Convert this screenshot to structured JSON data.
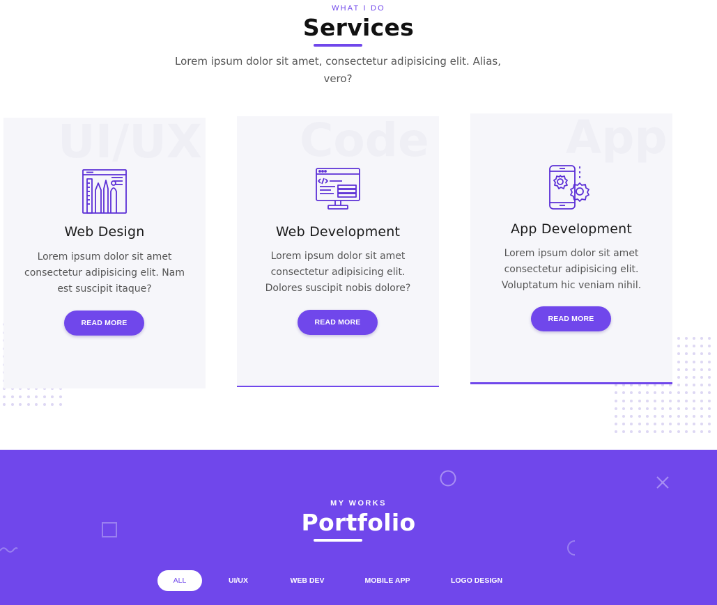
{
  "services": {
    "eyebrow": "WHAT I DO",
    "title": "Services",
    "intro": "Lorem ipsum dolor sit amet, consectetur adipisicing elit. Alias, vero?",
    "cards": [
      {
        "watermark": "UI/UX",
        "icon": "design-tools-icon",
        "title": "Web Design",
        "text": "Lorem ipsum dolor sit amet consectetur adipisicing elit. Nam est suscipit itaque?",
        "button": "READ MORE"
      },
      {
        "watermark": "Code",
        "icon": "code-monitor-icon",
        "title": "Web Development",
        "text": "Lorem ipsum dolor sit amet consectetur adipisicing elit. Dolores suscipit nobis dolore?",
        "button": "READ MORE"
      },
      {
        "watermark": "App",
        "icon": "mobile-gears-icon",
        "title": "App Development",
        "text": "Lorem ipsum dolor sit amet consectetur adipisicing elit. Voluptatum hic veniam nihil.",
        "button": "READ MORE"
      }
    ]
  },
  "portfolio": {
    "eyebrow": "MY WORKS",
    "title": "Portfolio",
    "filters": [
      "ALL",
      "UI/UX",
      "WEB DEV",
      "MOBILE APP",
      "LOGO DESIGN"
    ],
    "active_filter": "ALL"
  },
  "colors": {
    "accent": "#7047eb",
    "card_bg": "#f6f6fa",
    "dot": "#ddd7f3"
  }
}
